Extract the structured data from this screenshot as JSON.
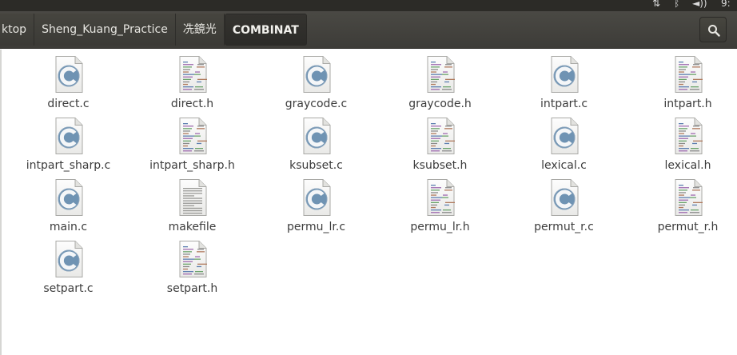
{
  "system_panel": {
    "clock": "9:"
  },
  "pathbar": {
    "crumbs": [
      "ktop",
      "Sheng_Kuang_Practice",
      "冼鏡光",
      "COMBINAT"
    ],
    "active_index": 3
  },
  "files": [
    {
      "name": "direct.c",
      "type": "c-source"
    },
    {
      "name": "direct.h",
      "type": "c-header"
    },
    {
      "name": "graycode.c",
      "type": "c-source"
    },
    {
      "name": "graycode.h",
      "type": "c-header"
    },
    {
      "name": "intpart.c",
      "type": "c-source"
    },
    {
      "name": "intpart.h",
      "type": "c-header"
    },
    {
      "name": "intpart_sharp.c",
      "type": "c-source"
    },
    {
      "name": "intpart_sharp.h",
      "type": "c-header"
    },
    {
      "name": "ksubset.c",
      "type": "c-source"
    },
    {
      "name": "ksubset.h",
      "type": "c-header"
    },
    {
      "name": "lexical.c",
      "type": "c-source"
    },
    {
      "name": "lexical.h",
      "type": "c-header"
    },
    {
      "name": "main.c",
      "type": "c-source"
    },
    {
      "name": "makefile",
      "type": "text"
    },
    {
      "name": "permu_lr.c",
      "type": "c-source"
    },
    {
      "name": "permu_lr.h",
      "type": "c-header"
    },
    {
      "name": "permut_r.c",
      "type": "c-source"
    },
    {
      "name": "permut_r.h",
      "type": "c-header"
    },
    {
      "name": "setpart.c",
      "type": "c-source"
    },
    {
      "name": "setpart.h",
      "type": "c-header"
    }
  ]
}
